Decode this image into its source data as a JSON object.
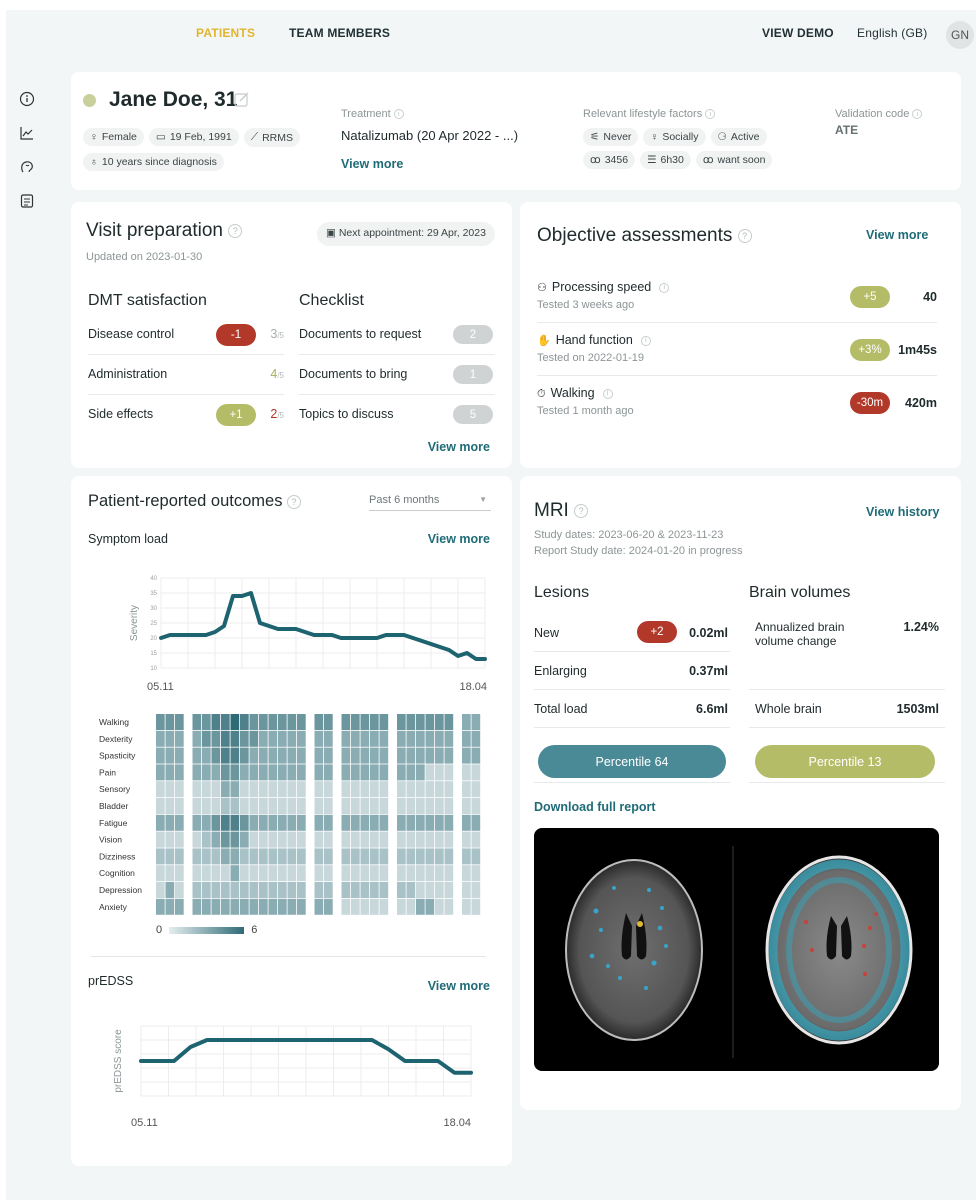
{
  "nav": {
    "patients": "PATIENTS",
    "team": "TEAM MEMBERS",
    "demo": "VIEW DEMO",
    "lang": "English (GB)",
    "avatar": "GN"
  },
  "sidebar": {
    "icons": [
      "info-icon",
      "line-chart-icon",
      "brain-icon",
      "list-icon"
    ]
  },
  "patient": {
    "name": "Jane Doe, 31",
    "chips1": [
      "Female",
      "19 Feb, 1991",
      "RRMS"
    ],
    "chip2": "10 years since diagnosis",
    "treatment_label": "Treatment",
    "treatment_value": "Natalizumab (20 Apr 2022 - ...)",
    "view_more": "View more",
    "lifestyle_label": "Relevant lifestyle factors",
    "lifestyle1": [
      "Never",
      "Socially",
      "Active"
    ],
    "lifestyle2": [
      "3456",
      "6h30",
      "want soon"
    ],
    "validation_label": "Validation code",
    "validation_value": "ATE",
    "status_color": "#c9d09b"
  },
  "visit": {
    "title": "Visit preparation",
    "updated": "Updated on 2023-01-30",
    "next_appt": "Next appointment: 29 Apr, 2023",
    "dmt_title": "DMT satisfaction",
    "checklist_title": "Checklist",
    "dmt": [
      {
        "label": "Disease control",
        "delta": "-1",
        "score": "3",
        "denom": "/5",
        "tone": "red"
      },
      {
        "label": "Administration",
        "delta": "",
        "score": "4",
        "denom": "/5",
        "tone": "green"
      },
      {
        "label": "Side effects",
        "delta": "+1",
        "score": "2",
        "denom": "/5",
        "tone": "green"
      }
    ],
    "checklist": [
      {
        "label": "Documents to request",
        "count": "2"
      },
      {
        "label": "Documents to bring",
        "count": "1"
      },
      {
        "label": "Topics to discuss",
        "count": "5"
      }
    ],
    "view_more": "View more"
  },
  "objective": {
    "title": "Objective assessments",
    "view_more": "View more",
    "items": [
      {
        "label": "Processing speed",
        "sub": "Tested 3 weeks ago",
        "delta": "+5",
        "value": "40",
        "tone": "green",
        "icon": "brain-icon"
      },
      {
        "label": "Hand function",
        "sub": "Tested on 2022-01-19",
        "delta": "+3%",
        "value": "1m45s",
        "tone": "green",
        "icon": "hand-icon"
      },
      {
        "label": "Walking",
        "sub": "Tested 1 month ago",
        "delta": "-30m",
        "value": "420m",
        "tone": "red",
        "icon": "timer-icon"
      }
    ]
  },
  "pro": {
    "title": "Patient-reported outcomes",
    "period": "Past 6 months",
    "symptom_title": "Symptom load",
    "view_more": "View more",
    "edss_title": "prEDSS",
    "edss_view_more": "View more",
    "legend_min": "0",
    "legend_max": "6",
    "heat_color": "#2f6b77"
  },
  "mri": {
    "title": "MRI",
    "view_history": "View history",
    "study_dates": "Study dates: 2023-06-20 & 2023-11-23",
    "report_date": "Report Study date: 2024-01-20 in progress",
    "lesions_title": "Lesions",
    "volumes_title": "Brain volumes",
    "lesions": [
      {
        "label": "New",
        "delta": "+2",
        "value": "0.02ml"
      },
      {
        "label": "Enlarging",
        "delta": "",
        "value": "0.37ml"
      },
      {
        "label": "Total load",
        "delta": "",
        "value": "6.6ml"
      }
    ],
    "volumes": [
      {
        "label": "Annualized brain volume change",
        "value": "1.24%"
      },
      {
        "label": "Whole brain",
        "value": "1503ml"
      }
    ],
    "percentile_lesions": "Percentile 64",
    "percentile_volumes": "Percentile 13",
    "download": "Download full report"
  },
  "chart_data": [
    {
      "type": "line",
      "title": "",
      "ylabel": "Severity",
      "xlabel": "",
      "x_tick_labels": [
        "05.11",
        "18.04"
      ],
      "y_ticks": [
        10,
        15,
        20,
        25,
        30,
        35,
        40
      ],
      "ylim": [
        10,
        40
      ],
      "grid": true,
      "color": "#1e6470",
      "values": [
        20,
        21,
        21,
        21,
        21,
        21,
        22,
        24,
        34,
        34,
        35,
        25,
        24,
        23,
        23,
        23,
        22,
        21,
        21,
        21,
        20,
        20,
        20,
        20,
        20,
        21,
        21,
        21,
        20,
        19,
        18,
        17,
        16,
        14,
        15,
        13,
        13
      ]
    },
    {
      "type": "heatmap",
      "rows": [
        "Walking",
        "Dexterity",
        "Spasticity",
        "Pain",
        "Sensory",
        "Bladder",
        "Fatigue",
        "Vision",
        "Dizziness",
        "Cognition",
        "Depression",
        "Anxiety"
      ],
      "columns": 24,
      "range": [
        0,
        6
      ],
      "gaps_after": [
        2,
        12,
        14,
        19,
        24
      ],
      "values": [
        [
          4,
          4,
          4,
          4,
          4,
          5,
          5,
          6,
          5,
          4,
          4,
          4,
          4,
          4,
          4,
          4,
          4,
          4,
          4,
          4,
          4,
          4,
          4,
          4,
          4,
          4,
          4,
          4,
          3,
          3,
          3,
          3
        ],
        [
          3,
          3,
          3,
          3,
          4,
          4,
          5,
          5,
          4,
          4,
          3,
          3,
          3,
          3,
          3,
          3,
          3,
          3,
          3,
          3,
          3,
          3,
          3,
          3,
          3,
          3,
          3,
          3,
          3,
          3,
          3,
          3
        ],
        [
          3,
          3,
          3,
          3,
          3,
          4,
          5,
          5,
          4,
          3,
          3,
          3,
          3,
          3,
          3,
          3,
          3,
          3,
          3,
          3,
          3,
          3,
          3,
          3,
          3,
          3,
          3,
          3,
          3,
          3,
          3,
          3
        ],
        [
          3,
          3,
          3,
          3,
          3,
          3,
          4,
          4,
          3,
          3,
          3,
          3,
          3,
          3,
          3,
          3,
          3,
          3,
          3,
          3,
          3,
          3,
          3,
          3,
          3,
          1,
          1,
          1,
          1,
          1,
          1,
          1
        ],
        [
          1,
          1,
          1,
          1,
          1,
          1,
          3,
          3,
          1,
          1,
          1,
          1,
          1,
          1,
          1,
          1,
          1,
          1,
          1,
          1,
          1,
          1,
          1,
          1,
          1,
          1,
          1,
          1,
          1,
          1,
          1,
          1
        ],
        [
          1,
          1,
          1,
          1,
          1,
          1,
          2,
          2,
          1,
          1,
          1,
          1,
          1,
          1,
          1,
          1,
          1,
          1,
          1,
          1,
          1,
          1,
          1,
          1,
          1,
          1,
          1,
          1,
          1,
          1,
          1,
          1
        ],
        [
          3,
          3,
          3,
          3,
          3,
          4,
          5,
          5,
          4,
          3,
          3,
          3,
          3,
          3,
          3,
          3,
          3,
          3,
          3,
          3,
          3,
          3,
          3,
          3,
          3,
          3,
          3,
          3,
          3,
          3,
          3,
          3
        ],
        [
          1,
          1,
          1,
          1,
          2,
          3,
          4,
          4,
          3,
          1,
          1,
          1,
          1,
          1,
          1,
          1,
          1,
          1,
          1,
          1,
          1,
          1,
          1,
          1,
          1,
          1,
          1,
          1,
          1,
          1,
          1,
          1
        ],
        [
          2,
          2,
          2,
          2,
          2,
          2,
          3,
          3,
          2,
          2,
          2,
          2,
          2,
          2,
          2,
          2,
          2,
          2,
          2,
          2,
          2,
          2,
          2,
          2,
          2,
          2,
          2,
          2,
          2,
          2,
          2,
          2
        ],
        [
          1,
          1,
          1,
          1,
          1,
          1,
          1,
          3,
          1,
          1,
          1,
          1,
          1,
          1,
          1,
          1,
          1,
          1,
          1,
          1,
          1,
          1,
          1,
          1,
          1,
          1,
          1,
          1,
          1,
          1,
          1,
          3
        ],
        [
          1,
          3,
          1,
          2,
          2,
          2,
          2,
          2,
          2,
          2,
          2,
          2,
          2,
          2,
          2,
          2,
          2,
          2,
          2,
          2,
          2,
          2,
          2,
          2,
          1,
          1,
          1,
          1,
          1,
          1,
          1,
          1
        ],
        [
          3,
          3,
          3,
          3,
          3,
          3,
          3,
          3,
          3,
          3,
          3,
          3,
          3,
          3,
          3,
          3,
          3,
          1,
          1,
          1,
          1,
          1,
          1,
          1,
          3,
          3,
          1,
          1,
          1,
          1,
          1,
          1
        ]
      ]
    },
    {
      "type": "line",
      "title": "",
      "ylabel": "prEDSS score",
      "xlabel": "",
      "x_tick_labels": [
        "05.11",
        "18.04"
      ],
      "grid": true,
      "color": "#1e6470",
      "values": [
        3,
        3,
        3,
        3.6,
        3.9,
        3.9,
        3.9,
        3.9,
        3.9,
        3.9,
        3.9,
        3.9,
        3.9,
        3.9,
        3.9,
        3.5,
        3,
        3,
        3,
        2.5,
        2.5
      ]
    }
  ]
}
